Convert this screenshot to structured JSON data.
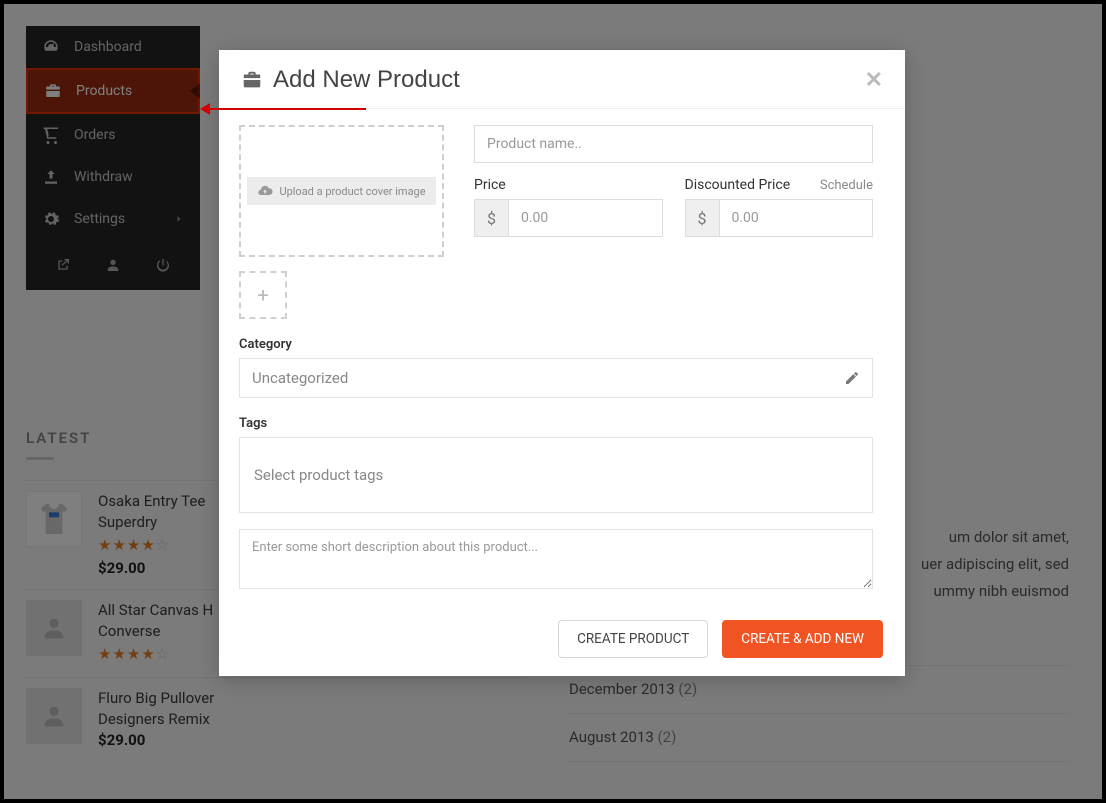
{
  "sidebar": {
    "items": [
      {
        "label": "Dashboard",
        "icon": "gauge-icon"
      },
      {
        "label": "Products",
        "icon": "briefcase-icon"
      },
      {
        "label": "Orders",
        "icon": "cart-icon"
      },
      {
        "label": "Withdraw",
        "icon": "upload-icon"
      },
      {
        "label": "Settings",
        "icon": "gear-icon"
      }
    ]
  },
  "modal": {
    "title": "Add New Product",
    "upload_label": "Upload a product cover image",
    "product_name_placeholder": "Product name..",
    "price_label": "Price",
    "discounted_label": "Discounted Price",
    "schedule_label": "Schedule",
    "currency": "$",
    "price_placeholder": "0.00",
    "discounted_placeholder": "0.00",
    "category_label": "Category",
    "category_value": "Uncategorized",
    "tags_label": "Tags",
    "tags_placeholder": "Select product tags",
    "description_placeholder": "Enter some short description about this product...",
    "create_label": "CREATE PRODUCT",
    "create_add_label": "CREATE & ADD NEW"
  },
  "latest": {
    "heading": "LATEST",
    "items": [
      {
        "title_a": "Osaka Entry Tee",
        "title_b": "Superdry",
        "price": "$29.00",
        "stars_full": "★★★★",
        "stars_empty": "☆"
      },
      {
        "title_a": "All Star Canvas H",
        "title_b": "Converse",
        "price": "",
        "stars_full": "★★★★",
        "stars_empty": "☆"
      },
      {
        "title_a": "Fluro Big Pullover",
        "title_b": "Designers Remix",
        "price": "$29.00",
        "stars_full": "",
        "stars_empty": ""
      }
    ]
  },
  "lorem": {
    "l1": "um dolor sit amet,",
    "l2": "uer adipiscing elit, sed",
    "l3": "ummy nibh euismod"
  },
  "archives": [
    {
      "label": "December 2013",
      "count": "(2)"
    },
    {
      "label": "August 2013",
      "count": "(2)"
    }
  ]
}
